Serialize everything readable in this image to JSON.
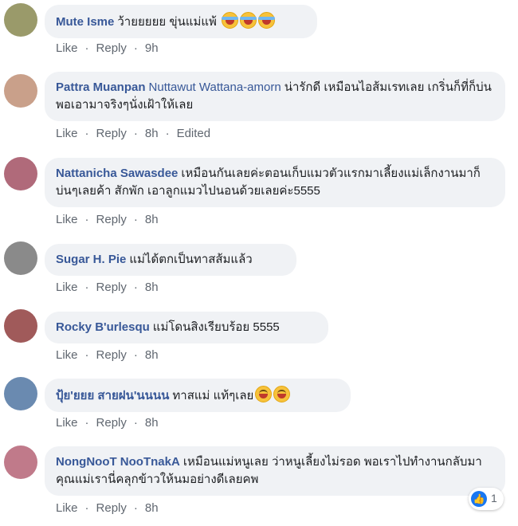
{
  "comments": [
    {
      "author": "Mute Isme",
      "mention": "",
      "text": "ว้ายยยยย ขุ่นแม่แพ้ ",
      "like": "Like",
      "reply": "Reply",
      "time": "9h",
      "edited": "",
      "avatar_color": "#9a9a6a",
      "emojis": [
        "tears-of-joy-emoji",
        "tears-of-joy-emoji",
        "tears-of-joy-emoji"
      ]
    },
    {
      "author": "Pattra Muanpan",
      "mention": "Nuttawut Wattana-amorn",
      "text": "น่ารักดี เหมือนไอส้มเรทเลย เกริ่นก็ที่ก็บ่น พอเอามาจริงๆนั่งเฝ้าให้เลย",
      "like": "Like",
      "reply": "Reply",
      "time": "8h",
      "edited": "Edited",
      "avatar_color": "#c9a08a",
      "emojis": []
    },
    {
      "author": "Nattanicha Sawasdee",
      "mention": "",
      "text": "เหมือนกันเลยค่ะตอนเก็บแมวตัวแรกมาเลี้ยงแม่เล็กงานมาก็บ่นๆเลยค้า สักพัก เอาลูกแมวไปนอนด้วยเลยค่ะ5555",
      "like": "Like",
      "reply": "Reply",
      "time": "8h",
      "edited": "",
      "avatar_color": "#b06a7a",
      "emojis": []
    },
    {
      "author": "Sugar H. Pie",
      "mention": "",
      "text": "แม่ได้ตกเป็นทาสส้มแล้ว",
      "like": "Like",
      "reply": "Reply",
      "time": "8h",
      "edited": "",
      "avatar_color": "#8a8a8a",
      "emojis": []
    },
    {
      "author": "Rocky B'urlesqu",
      "mention": "",
      "text": "แม่โดนสิงเรียบร้อย 5555",
      "like": "Like",
      "reply": "Reply",
      "time": "8h",
      "edited": "",
      "avatar_color": "#a05a5a",
      "emojis": []
    },
    {
      "author": "ปุ้ย'ยยย สายฝน'นนนน",
      "mention": "",
      "text": "ทาสแม่ แท้ๆเลย",
      "like": "Like",
      "reply": "Reply",
      "time": "8h",
      "edited": "",
      "avatar_color": "#6a8ab0",
      "emojis": [
        "grinning-face-emoji",
        "grinning-face-emoji"
      ]
    },
    {
      "author": "NongNooT NooTnakA",
      "mention": "",
      "text": "เหมือนแม่หนูเลย ว่าหนูเลี้ยงไม่รอด พอเราไปทำงานกลับมา คุณแม่เรานี่คลุกข้าวให้นมอย่างดีเลยคพ",
      "like": "Like",
      "reply": "Reply",
      "time": "8h",
      "edited": "",
      "avatar_color": "#c07a8a",
      "emojis": []
    }
  ],
  "reaction": {
    "icon": "thumbs-up-icon",
    "count": "1",
    "color": "#1877f2"
  }
}
